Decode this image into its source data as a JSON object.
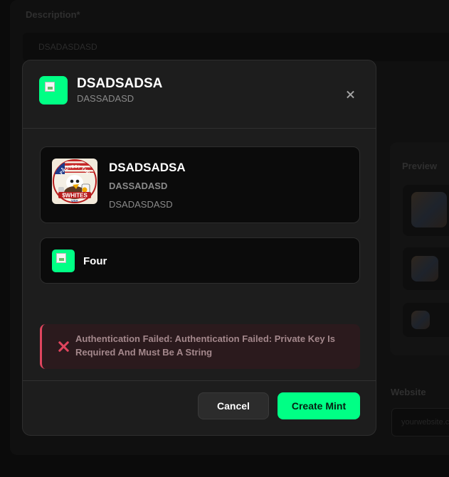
{
  "background": {
    "description_label": "Description*",
    "description_value": "DSADASDASD",
    "preview_label": "Preview",
    "website_label": "Website",
    "website_placeholder": "yourwebsite.com"
  },
  "modal": {
    "title": "DSADSADSA",
    "subtitle": "DASSADASD",
    "close_icon": "close-icon",
    "token": {
      "name": "DSADSADSA",
      "symbol": "DASSADASD",
      "description": "DSADASDASD",
      "logo_text": {
        "top": "PROTECT THE",
        "main": "$WHITES",
        "bottom": "USA"
      }
    },
    "platform": {
      "label": "Four"
    },
    "error": {
      "message": "Authentication Failed: Authentication Failed: Private Key Is Required And Must Be A String",
      "icon": "x-icon"
    },
    "buttons": {
      "cancel": "Cancel",
      "create": "Create Mint"
    }
  },
  "colors": {
    "accent": "#00ff85",
    "error": "#e0455e",
    "error_bg": "#2b1a1d",
    "modal_bg": "#1d1d1d",
    "card_bg": "#0b0b0b"
  }
}
